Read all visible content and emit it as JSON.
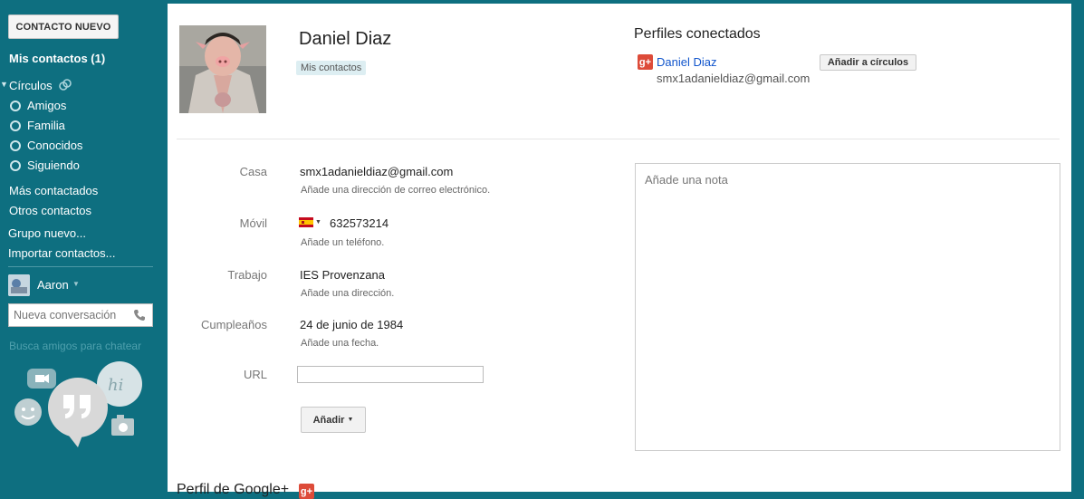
{
  "sidebar": {
    "new_contact": "CONTACTO NUEVO",
    "my_contacts": "Mis contactos (1)",
    "circles": "Círculos",
    "circle_items": [
      "Amigos",
      "Familia",
      "Conocidos",
      "Siguiendo"
    ],
    "most_contacted": "Más contactados",
    "other_contacts": "Otros contactos",
    "new_group": "Grupo nuevo...",
    "import": "Importar contactos...",
    "user_name": "Aaron",
    "chat_placeholder": "Nueva conversación",
    "find_friends": "Busca amigos para chatear"
  },
  "contact": {
    "name": "Daniel Diaz",
    "group_tag": "Mis contactos"
  },
  "connected": {
    "title": "Perfiles conectados",
    "profile_name": "Daniel Diaz",
    "profile_email": "smx1adanieldiaz@gmail.com",
    "add_circles": "Añadir a círculos"
  },
  "fields": {
    "home_label": "Casa",
    "home_value": "smx1adanieldiaz@gmail.com",
    "home_hint": "Añade una dirección de correo electrónico.",
    "mobile_label": "Móvil",
    "mobile_value": "632573214",
    "mobile_hint": "Añade un teléfono.",
    "work_label": "Trabajo",
    "work_value": "IES Provenzana",
    "work_hint": "Añade una dirección.",
    "birthday_label": "Cumpleaños",
    "birthday_value": "24 de junio de 1984",
    "birthday_hint": "Añade una fecha.",
    "url_label": "URL",
    "url_value": "",
    "add_button": "Añadir"
  },
  "note": {
    "placeholder": "Añade una nota"
  },
  "google_profile": {
    "title": "Perfil de Google+"
  },
  "colors": {
    "sidebar": "#0e6f80",
    "gplus": "#dd4b39",
    "link": "#1155cc"
  }
}
